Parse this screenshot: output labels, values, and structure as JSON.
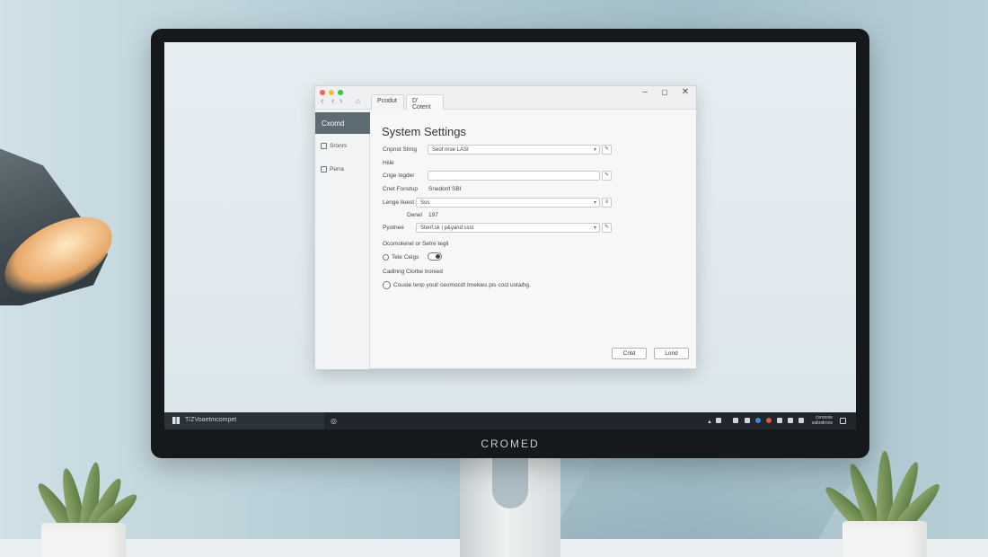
{
  "monitor": {
    "brand": "CROMED"
  },
  "window": {
    "tabs": [
      {
        "label": "Pcodut",
        "active": false
      },
      {
        "label": "D' Cotent",
        "active": true
      }
    ],
    "sidebar": {
      "active_label": "Cxomd",
      "items": [
        {
          "label": "Sronrs",
          "icon": "monitor-icon"
        },
        {
          "label": "Perra",
          "icon": "document-icon"
        }
      ]
    },
    "title": "System Settings",
    "fields": {
      "row1": {
        "label": "Cnpnst Strng",
        "value": "Seof nroe LASI"
      },
      "section1": "Hiile",
      "row2": {
        "label": "Cnge logder",
        "value": ""
      },
      "row3": {
        "label": "Cnet Fonstup",
        "value": "Snedonf SBI"
      },
      "row4": {
        "label": "Lenge lluest",
        "value": "Sos"
      },
      "row5": {
        "label": "Denel",
        "value": "197"
      },
      "row6": {
        "label": "Pyotnee",
        "value": "Stenf.sk | p&yand ssst"
      }
    },
    "section2": "Ocomolenel or Setre tegli",
    "radio_label": "Tele Ceigs",
    "section3": "Cadlnng Clorbe tronied",
    "checkbox_label": "Cousle tenp youl/ ceomocd! Imekies pis cost ustaihg.",
    "buttons": {
      "cancel": "Cntd",
      "ok": "Lond"
    }
  },
  "taskbar": {
    "search_text": "T/ZVoaetmcompet",
    "clock_line1": "cvronnie",
    "clock_line2": "sabodroos"
  }
}
